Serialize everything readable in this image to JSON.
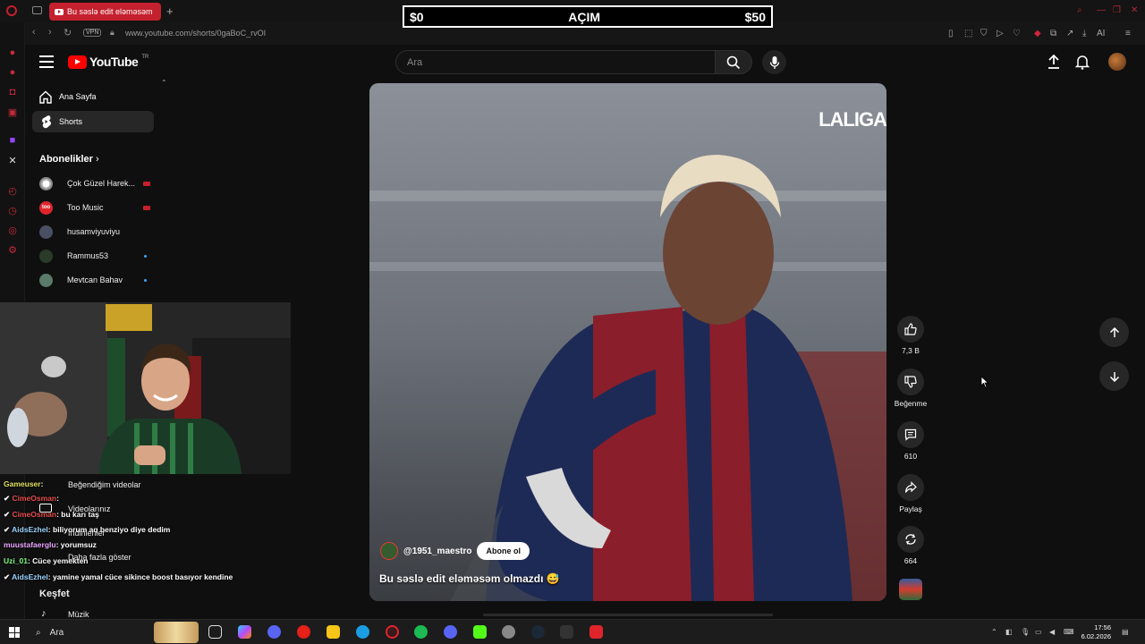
{
  "browser": {
    "tab_title": "Bu səslə edit eləməsəm",
    "url": "www.youtube.com/shorts/0gaBoC_rvOI",
    "vpn_label": "VPN",
    "new_tab": "+"
  },
  "overlay": {
    "left": "$0",
    "center": "AÇIM",
    "right": "$50"
  },
  "youtube": {
    "logo_text": "YouTube",
    "region": "TR",
    "search_placeholder": "Ara"
  },
  "sidebar": {
    "items": [
      {
        "label": "Ana Sayfa",
        "icon": "home-icon"
      },
      {
        "label": "Shorts",
        "icon": "shorts-icon"
      }
    ],
    "subscriptions_title": "Abonelikler",
    "subscriptions": [
      {
        "name": "Çok Güzel Harek...",
        "color": "#cfcfcf"
      },
      {
        "name": "Too Music",
        "color": "#e0242b"
      },
      {
        "name": "husamviyuviyu",
        "color": "#4a4f63"
      },
      {
        "name": "Rammus53",
        "color": "#2a3b2a"
      },
      {
        "name": "Mevtcan Bahav",
        "color": "#5a7a6a"
      }
    ],
    "lower": {
      "liked": "Beğendiğim videolar",
      "your_videos": "Videolarınız",
      "downloads": "İndirilenler",
      "show_more": "Daha fazla göster",
      "explore": "Keşfet",
      "music": "Müzik"
    }
  },
  "chat": [
    {
      "user": "Gameuser",
      "text": "",
      "color": "#e0e060"
    },
    {
      "user": "CimeOsman",
      "text": "",
      "color": "#e84c4c"
    },
    {
      "user": "CimeOsman",
      "text": "bu karı taş",
      "color": "#e84c4c"
    },
    {
      "user": "AidsEzhel",
      "text": "biliyorum aq benziyo diye dedim",
      "color": "#9bd3ff"
    },
    {
      "user": "muustafaerglu",
      "text": "yorumsuz",
      "color": "#e9a6ff"
    },
    {
      "user": "Uzi_01",
      "text": "Cüce yemekten",
      "color": "#7dfc7d"
    },
    {
      "user": "AidsEzhel",
      "text": "yamine yamal cüce sikince boost basıyor kendine",
      "color": "#9bd3ff"
    }
  ],
  "short": {
    "overlay_text": "LALIGA",
    "channel": "@1951_maestro",
    "subscribe_label": "Abone ol",
    "caption": "Bu səslə edit eləməsəm olmazdı 😅"
  },
  "actions": {
    "likes": "7,3 B",
    "dislike": "Beğenme",
    "comments": "610",
    "share": "Paylaş",
    "remix": "664"
  },
  "taskbar": {
    "search": "Ara",
    "time": "17:56",
    "date": "6.02.2026"
  }
}
